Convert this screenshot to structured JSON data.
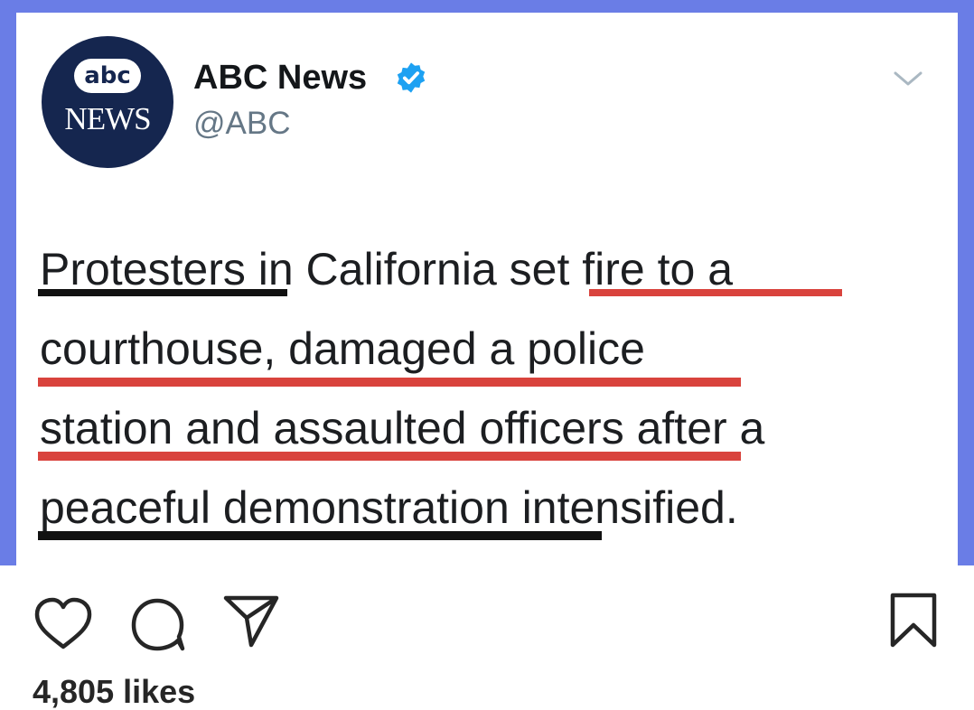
{
  "tweet": {
    "avatar": {
      "abc_text": "abc",
      "news_text": "NEWS"
    },
    "account_name": "ABC News",
    "handle": "@ABC",
    "icons": {
      "verified": "verified-badge-icon",
      "menu": "chevron-down-icon"
    },
    "text": {
      "line1": {
        "a": "Protesters",
        "b": " in California ",
        "c": "set fire to a"
      },
      "line2": "courthouse, damaged a police",
      "line3": {
        "a": "station and assaulted officers",
        "b": " after a"
      },
      "line4": {
        "a": "peaceful demonstration",
        "b": " intensified."
      }
    },
    "colors": {
      "frame": "#6a7de6",
      "navy": "#15264f",
      "verified": "#1da1f2",
      "underline_red": "#d9433d",
      "underline_black": "#111111"
    }
  },
  "instagram": {
    "icons": [
      "heart-icon",
      "comment-icon",
      "share-icon",
      "bookmark-icon"
    ],
    "likes": "4,805 likes"
  }
}
